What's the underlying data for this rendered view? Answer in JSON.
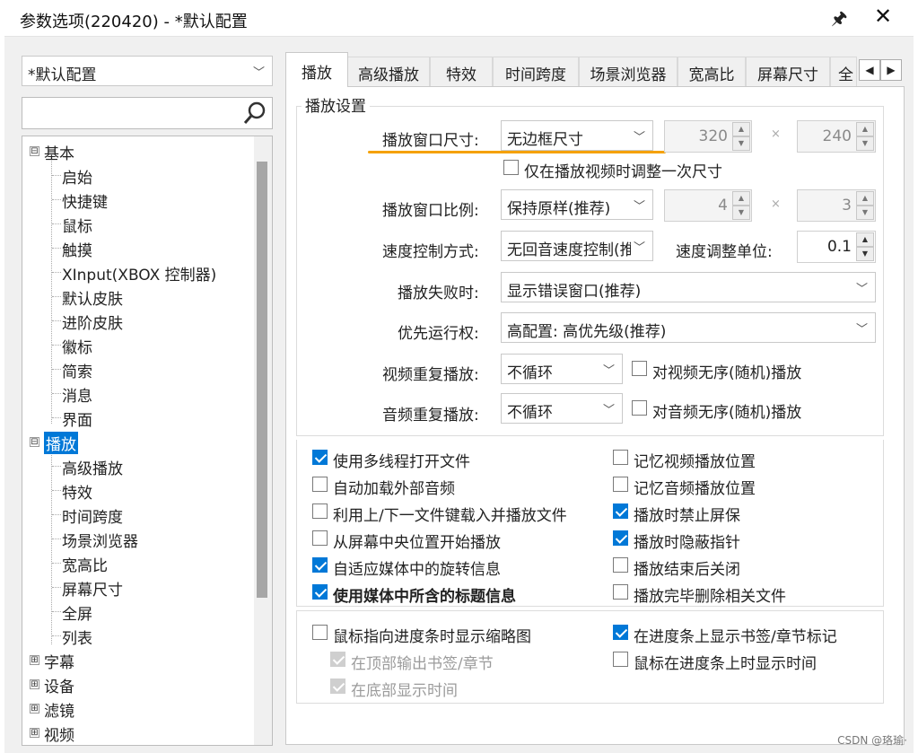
{
  "window": {
    "title": "参数选项(220420) - *默认配置",
    "pin_glyph": "🖈",
    "close_glyph": "✕"
  },
  "sidebar": {
    "profile": "*默认配置",
    "search_placeholder": "",
    "tree": {
      "basic": {
        "label": "基本",
        "expander": "⊟",
        "children": [
          "启始",
          "快捷键",
          "鼠标",
          "触摸",
          "XInput(XBOX 控制器)",
          "默认皮肤",
          "进阶皮肤",
          "徽标",
          "简索",
          "消息",
          "界面"
        ]
      },
      "play": {
        "label": "播放",
        "expander": "⊟",
        "children": [
          "高级播放",
          "特效",
          "时间跨度",
          "场景浏览器",
          "宽高比",
          "屏幕尺寸",
          "全屏",
          "列表"
        ]
      },
      "collapsed": [
        {
          "label": "字幕",
          "expander": "⊞"
        },
        {
          "label": "设备",
          "expander": "⊞"
        },
        {
          "label": "滤镜",
          "expander": "⊞"
        },
        {
          "label": "视频",
          "expander": "⊞"
        }
      ]
    }
  },
  "tabs": [
    "播放",
    "高级播放",
    "特效",
    "时间跨度",
    "场景浏览器",
    "宽高比",
    "屏幕尺寸",
    "全"
  ],
  "tab_nav": {
    "prev": "◀",
    "next": "▶"
  },
  "settings": {
    "group_title": "播放设置",
    "window_size": {
      "label": "播放窗口尺寸:",
      "value": "无边框尺寸",
      "width": "320",
      "times": "×",
      "height": "240"
    },
    "adjust_once": "仅在播放视频时调整一次尺寸",
    "ratio": {
      "label": "播放窗口比例:",
      "value": "保持原样(推荐)",
      "a": "4",
      "times": "×",
      "b": "3"
    },
    "speed": {
      "label": "速度控制方式:",
      "value": "无回音速度控制(推",
      "unit_label": "速度调整单位:",
      "unit_value": "0.1"
    },
    "fail": {
      "label": "播放失败时:",
      "value": "显示错误窗口(推荐)"
    },
    "priority": {
      "label": "优先运行权:",
      "value": "高配置: 高优先级(推荐)"
    },
    "video_repeat": {
      "label": "视频重复播放:",
      "value": "不循环",
      "random": "对视频无序(随机)播放"
    },
    "audio_repeat": {
      "label": "音频重复播放:",
      "value": "不循环",
      "random": "对音频无序(随机)播放"
    }
  },
  "options": {
    "left": [
      {
        "label": "使用多线程打开文件",
        "checked": true
      },
      {
        "label": "自动加载外部音频",
        "checked": false
      },
      {
        "label": "利用上/下一文件键载入并播放文件",
        "checked": false
      },
      {
        "label": "从屏幕中央位置开始播放",
        "checked": false
      },
      {
        "label": "自适应媒体中的旋转信息",
        "checked": true
      },
      {
        "label": "使用媒体中所含的标题信息",
        "checked": true
      }
    ],
    "right": [
      {
        "label": "记忆视频播放位置",
        "checked": false
      },
      {
        "label": "记忆音频播放位置",
        "checked": false
      },
      {
        "label": "播放时禁止屏保",
        "checked": true
      },
      {
        "label": "播放时隐蔽指针",
        "checked": true
      },
      {
        "label": "播放结束后关闭",
        "checked": false
      },
      {
        "label": "播放完毕删除相关文件",
        "checked": false
      }
    ],
    "thumbnail": {
      "label": "鼠标指向进度条时显示缩略图",
      "checked": false
    },
    "top_bookmark": {
      "label": "在顶部输出书签/章节",
      "checked": true
    },
    "bottom_time": {
      "label": "在底部显示时间",
      "checked": true
    },
    "show_bookmarks": {
      "label": "在进度条上显示书签/章节标记",
      "checked": true
    },
    "hover_time": {
      "label": "鼠标在进度条上时显示时间",
      "checked": false
    }
  },
  "watermark": "CSDN @珞瑜·",
  "colors": {
    "accent": "#0078d7",
    "underline": "#f5a100"
  }
}
